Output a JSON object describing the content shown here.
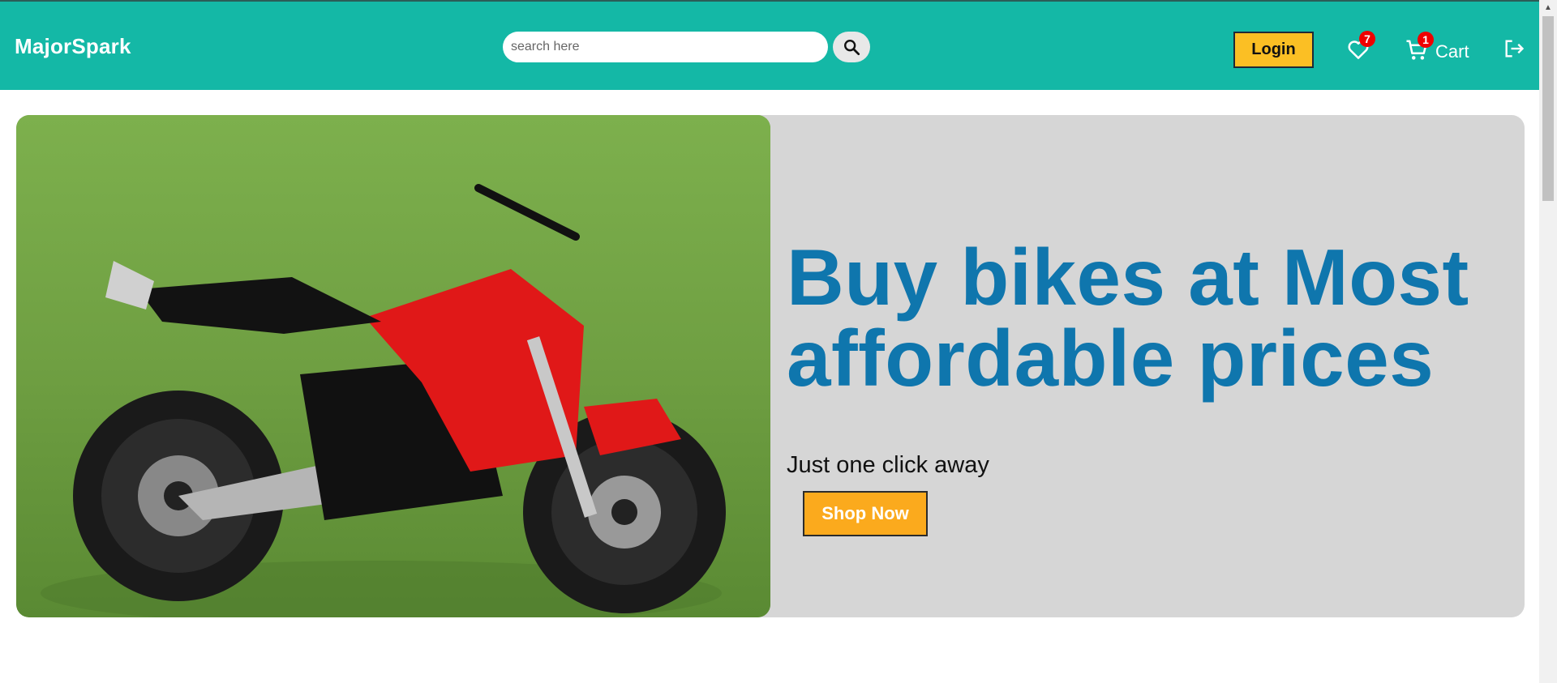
{
  "header": {
    "brand": "MajorSpark",
    "search": {
      "placeholder": "search here",
      "value": ""
    },
    "login_label": "Login",
    "wishlist_count": "7",
    "cart_count": "1",
    "cart_label": "Cart"
  },
  "hero": {
    "headline_line1": "Buy bikes at Most",
    "headline_line2": "affordable prices",
    "subline": "Just one click away",
    "cta_label": "Shop Now",
    "image_subject": "red-electric-motorcycle-on-grass"
  },
  "icons": {
    "search": "search-icon",
    "wishlist": "heart-icon",
    "cart": "cart-icon",
    "logout": "logout-icon"
  },
  "colors": {
    "navbar": "#14b8a6",
    "accent_button": "#fbbf24",
    "headline": "#0f76ad",
    "hero_bg": "#d6d6d6",
    "badge": "#ef0000"
  }
}
